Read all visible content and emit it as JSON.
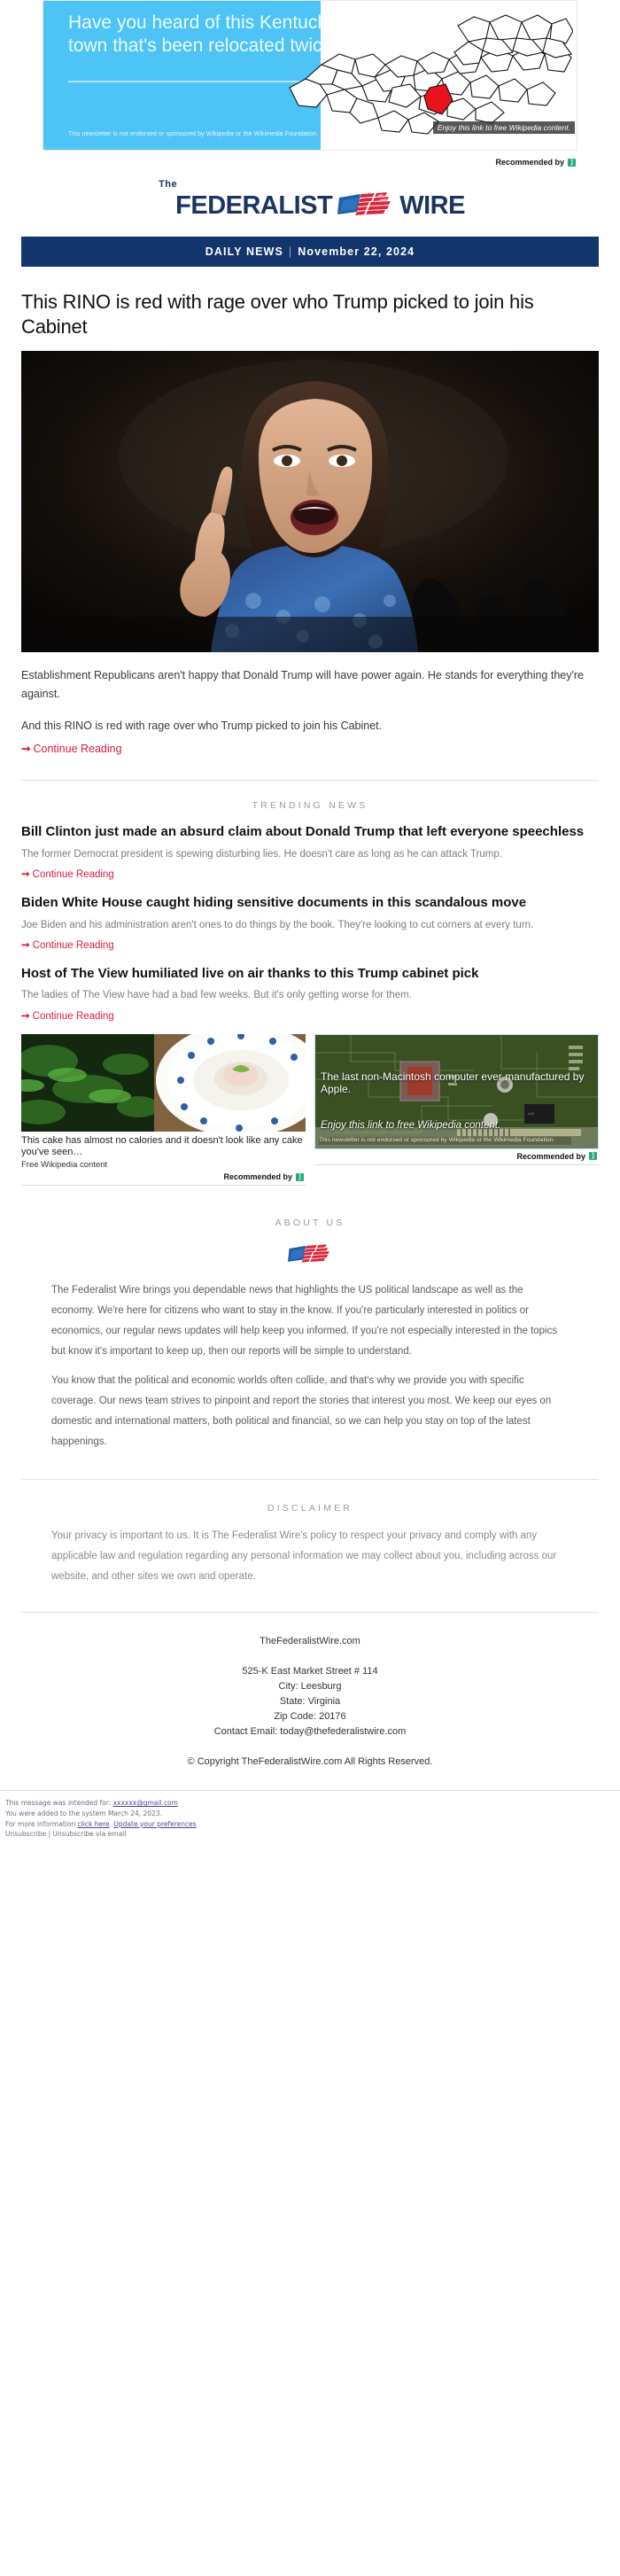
{
  "top_ad": {
    "headline": "Have you heard of this Kentucky town that's been relocated twice?",
    "disclaimer": "This newsletter is not endorsed or sponsored by Wikipedia or the Wikimedia Foundation.",
    "caption": "Enjoy this link to free Wikipedia content.",
    "recommended_by": "Recommended by",
    "provider_mark": "]"
  },
  "brand": {
    "the": "The",
    "word1": "FEDERALIST",
    "word2": "WIRE"
  },
  "datebar": {
    "label": "DAILY NEWS",
    "separator": "|",
    "date": "November 22, 2024"
  },
  "lead_story": {
    "headline": "This RINO is red with rage over who Trump picked to join his Cabinet",
    "paragraph1": "Establishment Republicans aren't happy that Donald Trump will have power again. He stands for everything they're against.",
    "paragraph2": "And this RINO is red with rage over who Trump picked to join his Cabinet.",
    "cta": "Continue Reading"
  },
  "trending": {
    "label": "TRENDING NEWS",
    "items": [
      {
        "headline": "Bill Clinton just made an absurd claim about Donald Trump that left everyone speechless",
        "summary": "The former Democrat president is spewing disturbing lies. He doesn't care as long as he can attack Trump.",
        "cta": "Continue Reading"
      },
      {
        "headline": "Biden White House caught hiding sensitive documents in this scandalous move",
        "summary": "Joe Biden and his administration aren't ones to do things by the book. They're looking to cut corners at every turn.",
        "cta": "Continue Reading"
      },
      {
        "headline": "Host of The View humiliated live on air thanks to this Trump cabinet pick",
        "summary": "The ladies of The View have had a bad few weeks. But it's only getting worse for them.",
        "cta": "Continue Reading"
      }
    ]
  },
  "bottom_ads": {
    "left": {
      "title": "This cake has almost no calories and it doesn't look like any cake you've seen…",
      "source": "Free Wikipedia content",
      "recommended_by": "Recommended by",
      "provider_mark": "]"
    },
    "right": {
      "title": "The last non-Macintosh computer ever manufactured by Apple.",
      "subtitle": "Enjoy this link to free Wikipedia content.",
      "disclaimer": "This newsletter is not endorsed or sponsored by Wikipedia or the Wikimedia Foundation.",
      "recommended_by": "Recommended by",
      "provider_mark": "]"
    }
  },
  "about": {
    "label": "ABOUT US",
    "paragraph1": "The Federalist Wire brings you dependable news that highlights the US political landscape as well as the economy. We're here for citizens who want to stay in the know. If you're particularly interested in politics or economics, our regular news updates will help keep you informed. If you're not especially interested in the topics but know it's important to keep up, then our reports will be simple to understand.",
    "paragraph2": "You know that the political and economic worlds often collide, and that's why we provide you with specific coverage. Our news team strives to pinpoint and report the stories that interest you most. We keep our eyes on domestic and international matters, both political and financial, so we can help you stay on top of the latest happenings."
  },
  "disclaimer": {
    "label": "DISCLAIMER",
    "text": "Your privacy is important to us. It is The Federalist Wire's policy to respect your privacy and comply with any applicable law and regulation regarding any personal information we may collect about you, including across our website, and other sites we own and operate."
  },
  "footer": {
    "site": "TheFederalistWire.com",
    "address": "525-K East Market Street # 114",
    "city": "City: Leesburg",
    "state": "State: Virginia",
    "zip": "Zip Code: 20176",
    "email": "Contact Email: today@thefederalistwire.com",
    "copyright": "© Copyright TheFederalistWire.com All Rights Reserved."
  },
  "email_footer": {
    "intended_prefix": "This message was intended for: ",
    "intended_email": "xxxxxx@gmail.com",
    "added_line": "You were added to the system March 24, 2023.",
    "more_prefix": "For more information ",
    "click_here": "click here",
    "more_mid": ". ",
    "update_prefs": "Update your preferences",
    "unsubscribe": "Unsubscribe",
    "unsub_sep": " | ",
    "unsubscribe_email": "Unsubscribe via email"
  },
  "colors": {
    "brand_navy": "#12356b",
    "accent_red": "#d81b3c",
    "ad_blue": "#4ec3f5",
    "provider_green": "#2aa879"
  }
}
